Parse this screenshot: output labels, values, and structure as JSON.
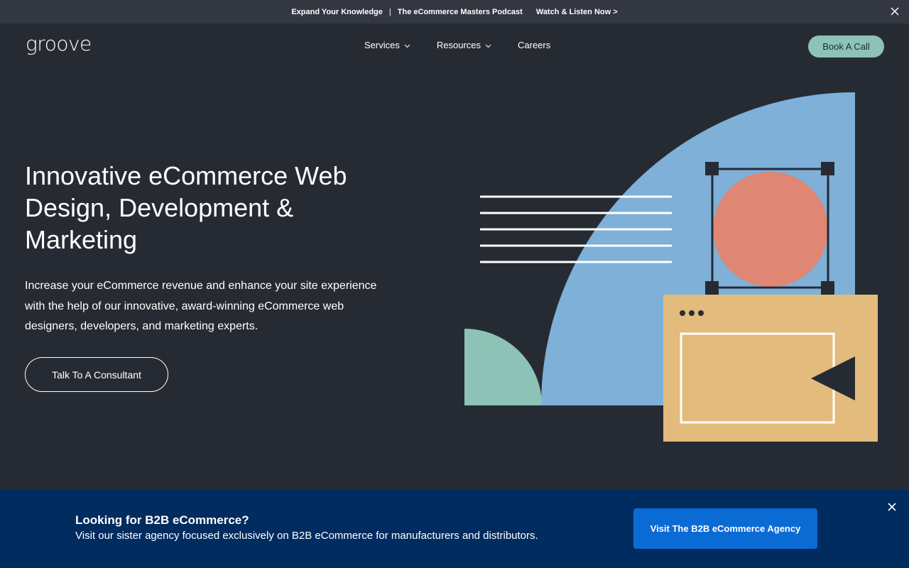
{
  "announcement": {
    "text_left": "Expand Your Knowledge",
    "separator": "|",
    "text_middle": "The eCommerce Masters Podcast",
    "link_text": "Watch & Listen Now >",
    "close_icon": "close-icon"
  },
  "nav": {
    "logo_text": "groove",
    "items": [
      {
        "label": "Services",
        "has_dropdown": true
      },
      {
        "label": "Resources",
        "has_dropdown": true
      },
      {
        "label": "Careers",
        "has_dropdown": false
      }
    ],
    "cta_label": "Book A Call"
  },
  "hero": {
    "title": "Innovative eCommerce Web Design, Development & Marketing",
    "subtitle": "Increase your eCommerce revenue and enhance your site experience with the help of our innovative, award-winning eCommerce web designers, developers, and marketing experts.",
    "cta_label": "Talk To A Consultant"
  },
  "b2b_banner": {
    "title": "Looking for B2B eCommerce?",
    "text": "Visit our sister agency focused exclusively on B2B eCommerce for manufacturers and distributors.",
    "button_label": "Visit The B2B eCommerce Agency",
    "close_icon": "close-icon"
  },
  "colors": {
    "page_bg": "#262b33",
    "announcement_bg": "#333741",
    "accent_teal": "#8dc3b6",
    "illustration_blue": "#7eb0d8",
    "illustration_coral": "#df8675",
    "illustration_sand": "#e3bb7c",
    "banner_bg": "#012c5f",
    "banner_button": "#0b6bd4"
  }
}
